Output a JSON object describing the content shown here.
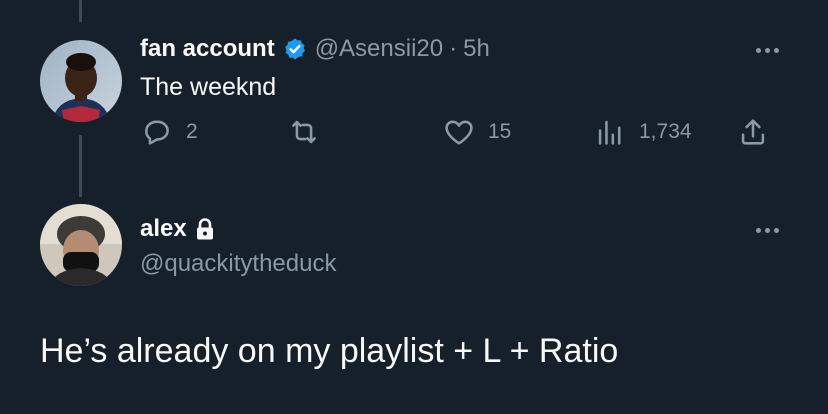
{
  "tweet": {
    "display_name": "fan account",
    "handle": "@Asensii20",
    "separator": "·",
    "time": "5h",
    "text": "The weeknd",
    "actions": {
      "reply_count": "2",
      "retweet_count": "",
      "like_count": "15",
      "views_count": "1,734"
    }
  },
  "reply": {
    "display_name": "alex",
    "handle": "@quackitytheduck",
    "text": "He’s already on my playlist + L + Ratio"
  },
  "colors": {
    "background": "#15202b",
    "text_primary": "#f7f9f9",
    "text_secondary": "#8b98a5",
    "verified_blue": "#1d9bf0",
    "thread_line": "#3e4a56"
  },
  "icons": {
    "verified": "verified-badge-icon",
    "lock": "lock-icon",
    "reply": "reply-icon",
    "retweet": "retweet-icon",
    "like": "heart-icon",
    "views": "views-icon",
    "share": "share-icon",
    "more": "more-icon"
  }
}
